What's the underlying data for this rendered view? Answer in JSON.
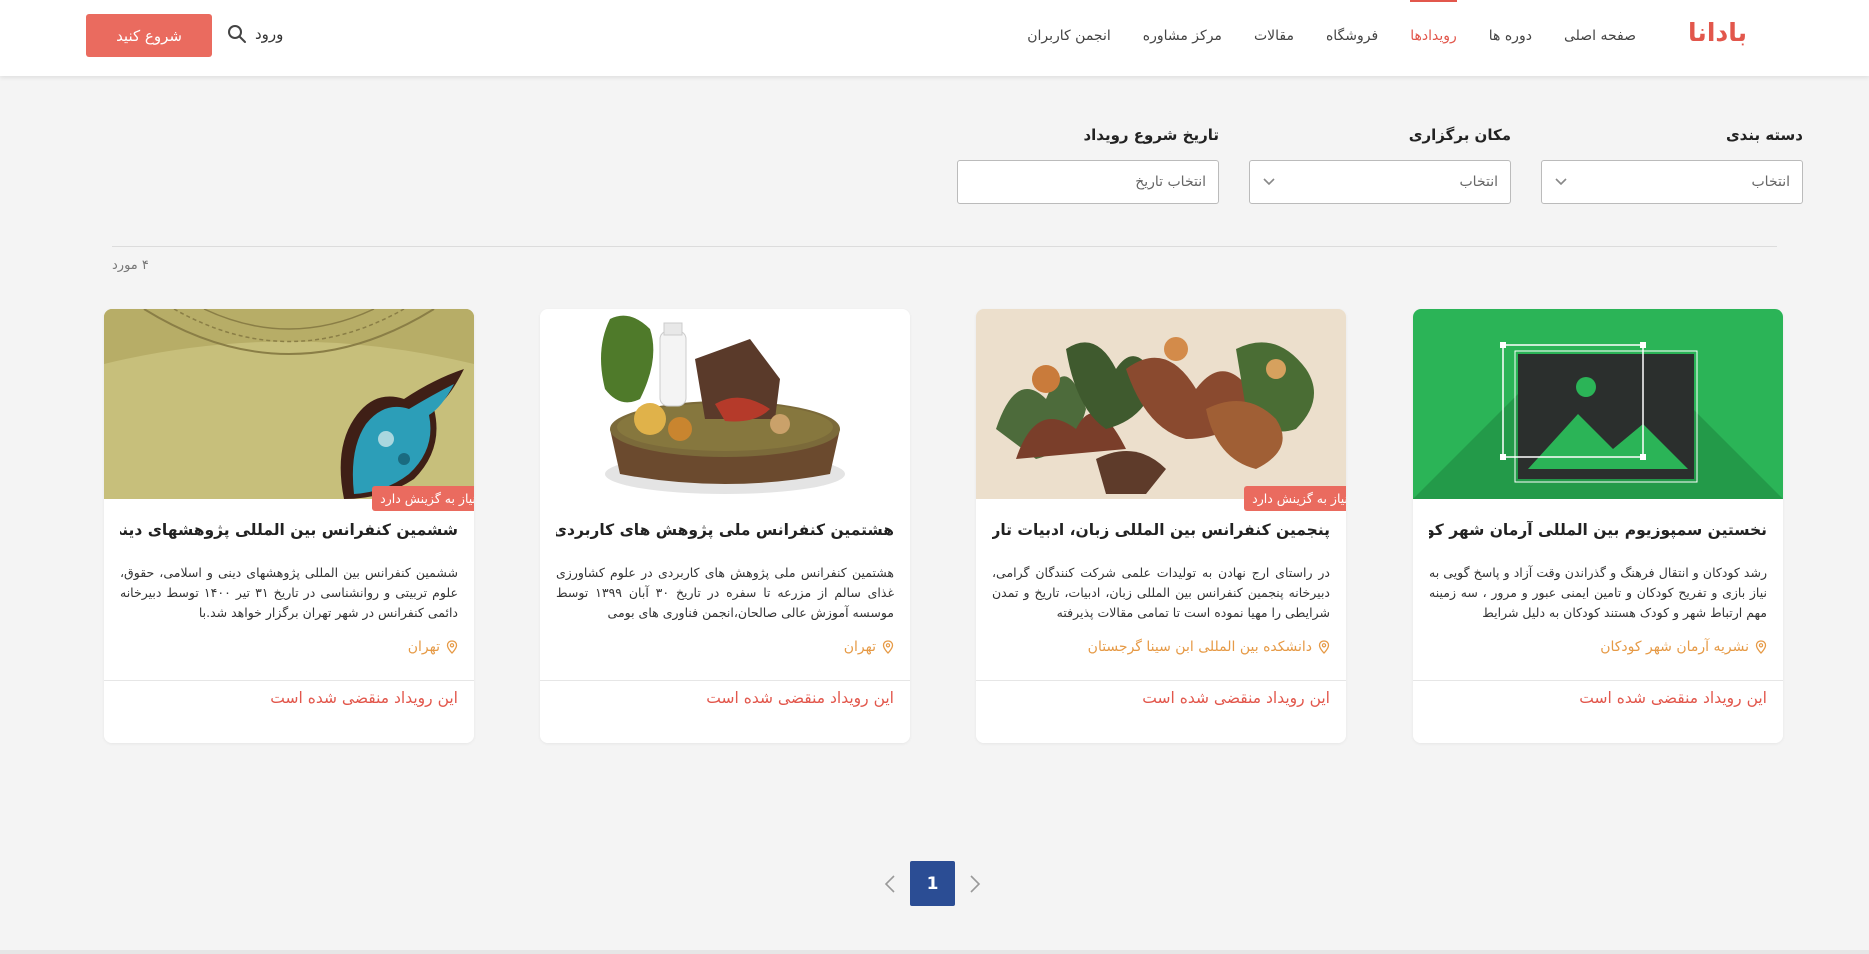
{
  "header": {
    "logo": "بادانا",
    "nav": [
      {
        "label": "صفحه اصلی",
        "active": false
      },
      {
        "label": "دوره ها",
        "active": false
      },
      {
        "label": "رویدادها",
        "active": true
      },
      {
        "label": "فروشگاه",
        "active": false
      },
      {
        "label": "مقالات",
        "active": false
      },
      {
        "label": "مرکز مشاوره",
        "active": false
      },
      {
        "label": "انجمن کاربران",
        "active": false
      }
    ],
    "login_label": "ورود",
    "start_label": "شروع کنید",
    "accent_color": "#e2574c"
  },
  "filters": {
    "category": {
      "label": "دسته بندی",
      "value": "انتخاب"
    },
    "location": {
      "label": "مکان برگزاری",
      "value": "انتخاب"
    },
    "date": {
      "label": "تاریخ شروع رویداد",
      "placeholder": "انتخاب تاریخ"
    }
  },
  "results_count": "۴ مورد",
  "cards": [
    {
      "title": "نخستین سمپوزیوم بین المللی آرمان شهر کودکان",
      "description": "رشد کودکان و انتقال فرهنگ و گذراندن وقت آزاد و پاسخ گویی به نیاز بازی و تفریح کودکان و تامین ایمنی عبور و مرور ، سه زمینه مهم ارتباط شهر و کودک هستند کودکان به دلیل شرایط",
      "location": "نشریه آرمان شهر کودکان",
      "status": "این رویداد منقضی شده است",
      "badge": "",
      "image": "placeholder-image"
    },
    {
      "title": "پنجمین کنفرانس بین المللی زبان، ادبیات تاریخ ...",
      "description": "در راستای ارج نهادن به تولیدات علمی شرکت کنندگان گرامی، دبیرخانه پنجمین کنفرانس بین المللی زبان، ادبیات، تاریخ و تمدن شرایطی را مهیا نموده است تا تمامی مقالات پذیرفته",
      "location": "دانشکده بین المللی ابن سینا گرجستان",
      "status": "این رویداد منقضی شده است",
      "badge": "نیاز به گزینش دارد",
      "image": "persian-miniature-painting"
    },
    {
      "title": "هشتمین کنفرانس ملی پژوهش های کاربردی د...",
      "description": "هشتمین کنفرانس ملی پژوهش های کاربردی در علوم کشاورزی غذای سالم از مزرعه تا سفره در تاریخ ۳۰ آبان ۱۳۹۹ توسط موسسه آموزش عالی صالحان،انجمن فناوری های بومی",
      "location": "تهران",
      "status": "این رویداد منقضی شده است",
      "badge": "",
      "image": "food-on-soil-disc"
    },
    {
      "title": "ششمین کنفرانس بین المللی پژوهشهای دینی و...",
      "description": "ششمین کنفرانس بین المللی پژوهشهای دینی و اسلامی، حقوق، علوم تربیتی و روانشناسی در تاریخ ۳۱ تیر ۱۴۰۰ توسط دبیرخانه دائمی کنفرانس در شهر تهران برگزار خواهد شد.با",
      "location": "تهران",
      "status": "این رویداد منقضی شده است",
      "badge": "نیاز به گزینش دارد",
      "image": "dove-ornament"
    }
  ],
  "pagination": {
    "current": "1"
  }
}
